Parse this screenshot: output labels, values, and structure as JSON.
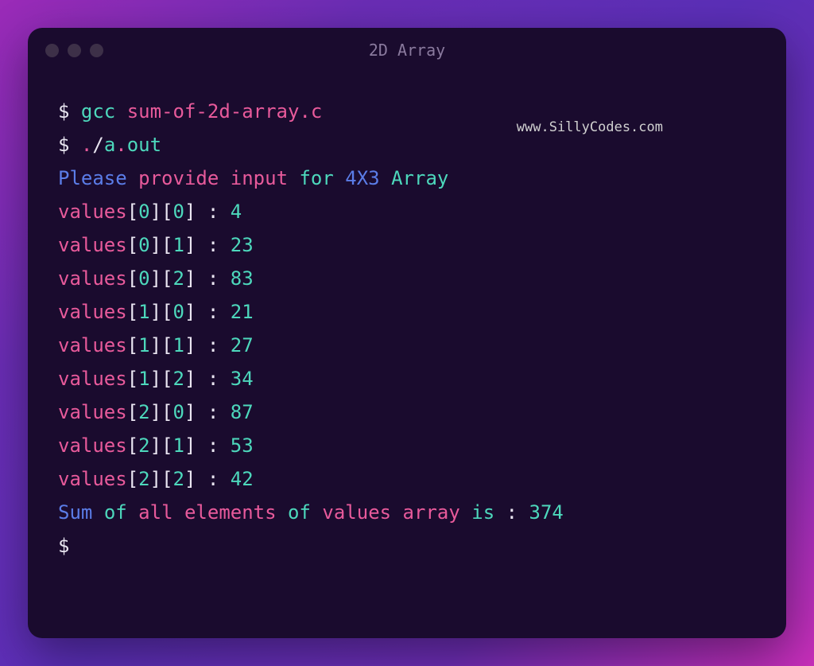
{
  "window": {
    "title": "2D Array"
  },
  "watermark": "www.SillyCodes.com",
  "terminal": {
    "prompt": "$",
    "compile": {
      "cmd": "gcc",
      "file": "sum-of-2d-array.c"
    },
    "run": {
      "dot": ".",
      "slash": "/",
      "a": "a",
      "dot2": ".",
      "out": "out"
    },
    "input_prompt": {
      "please": "Please",
      "provide": "provide",
      "input": "input",
      "for": "for",
      "dims": "4X3",
      "array": "Array"
    },
    "values_label": "values",
    "entries": [
      {
        "i": "0",
        "j": "0",
        "val": "4"
      },
      {
        "i": "0",
        "j": "1",
        "val": "23"
      },
      {
        "i": "0",
        "j": "2",
        "val": "83"
      },
      {
        "i": "1",
        "j": "0",
        "val": "21"
      },
      {
        "i": "1",
        "j": "1",
        "val": "27"
      },
      {
        "i": "1",
        "j": "2",
        "val": "34"
      },
      {
        "i": "2",
        "j": "0",
        "val": "87"
      },
      {
        "i": "2",
        "j": "1",
        "val": "53"
      },
      {
        "i": "2",
        "j": "2",
        "val": "42"
      }
    ],
    "result": {
      "sum": "Sum",
      "of": "of",
      "all": "all",
      "elements": "elements",
      "of2": "of",
      "values": "values",
      "array": "array",
      "is": "is",
      "colon": ":",
      "value": "374"
    }
  }
}
